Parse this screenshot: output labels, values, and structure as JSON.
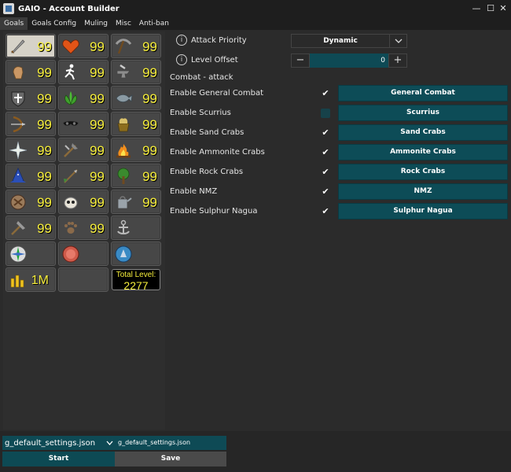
{
  "window": {
    "title": "GAIO - Account Builder",
    "controls": [
      "minimize-icon",
      "maximize-icon",
      "close-icon"
    ]
  },
  "tabs": [
    {
      "label": "Goals",
      "active": true
    },
    {
      "label": "Goals Config",
      "active": false
    },
    {
      "label": "Muling",
      "active": false
    },
    {
      "label": "Misc",
      "active": false
    },
    {
      "label": "Anti-ban",
      "active": false
    }
  ],
  "skills": [
    {
      "icon": "attack-icon",
      "level": "99",
      "selected": true
    },
    {
      "icon": "hitpoints-icon",
      "level": "99"
    },
    {
      "icon": "mining-icon",
      "level": "99"
    },
    {
      "icon": "strength-icon",
      "level": "99"
    },
    {
      "icon": "agility-icon",
      "level": "99"
    },
    {
      "icon": "smithing-icon",
      "level": "99"
    },
    {
      "icon": "defence-icon",
      "level": "99"
    },
    {
      "icon": "herblore-icon",
      "level": "99"
    },
    {
      "icon": "fishing-icon",
      "level": "99"
    },
    {
      "icon": "ranged-icon",
      "level": "99"
    },
    {
      "icon": "thieving-icon",
      "level": "99"
    },
    {
      "icon": "cooking-icon",
      "level": "99"
    },
    {
      "icon": "prayer-icon",
      "level": "99"
    },
    {
      "icon": "crafting-icon",
      "level": "99"
    },
    {
      "icon": "firemaking-icon",
      "level": "99"
    },
    {
      "icon": "magic-icon",
      "level": "99"
    },
    {
      "icon": "fletching-icon",
      "level": "99"
    },
    {
      "icon": "woodcutting-icon",
      "level": "99"
    },
    {
      "icon": "runecraft-icon",
      "level": "99"
    },
    {
      "icon": "slayer-icon",
      "level": "99"
    },
    {
      "icon": "farming-icon",
      "level": "99"
    },
    {
      "icon": "construction-icon",
      "level": "99"
    },
    {
      "icon": "hunter-icon",
      "level": "99"
    },
    {
      "icon": "sailing-icon",
      "level": ""
    },
    {
      "icon": "quest-icon-green",
      "level": ""
    },
    {
      "icon": "quest-icon-red",
      "level": ""
    },
    {
      "icon": "quest-icon-blue",
      "level": ""
    }
  ],
  "gp": {
    "icon": "coins-icon",
    "value": "1M"
  },
  "total_level": {
    "label": "Total Level:",
    "value": "2277"
  },
  "settings": {
    "attack_priority": {
      "label": "Attack Priority",
      "value": "Dynamic"
    },
    "level_offset": {
      "label": "Level Offset",
      "value": "0",
      "minus": "−",
      "plus": "+"
    },
    "section": "Combat - attack",
    "rows": [
      {
        "label": "Enable General Combat",
        "checked": true,
        "button": "General Combat"
      },
      {
        "label": "Enable Scurrius",
        "checked": false,
        "button": "Scurrius"
      },
      {
        "label": "Enable Sand Crabs",
        "checked": true,
        "button": "Sand Crabs"
      },
      {
        "label": "Enable Ammonite Crabs",
        "checked": true,
        "button": "Ammonite Crabs"
      },
      {
        "label": "Enable Rock Crabs",
        "checked": true,
        "button": "Rock Crabs"
      },
      {
        "label": "Enable NMZ",
        "checked": true,
        "button": "NMZ"
      },
      {
        "label": "Enable Sulphur Nagua",
        "checked": true,
        "button": "Sulphur Nagua"
      }
    ]
  },
  "bottom": {
    "file_select": "g_default_settings.json",
    "file_input": "g_default_settings.json",
    "start": "Start",
    "save": "Save"
  },
  "colors": {
    "background": "#2b2b2b",
    "teal": "#0d4c57",
    "level_yellow": "#f6ee3b"
  }
}
